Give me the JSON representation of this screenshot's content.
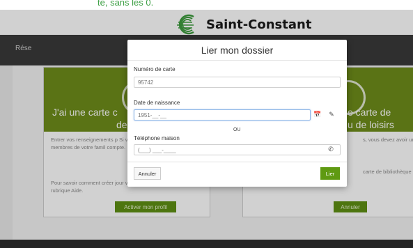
{
  "top_strip": {
    "text": "te, sans les 0."
  },
  "header": {
    "logo_text": "Saint-Constant"
  },
  "navbar": {
    "item": "Rése"
  },
  "cards": {
    "left": {
      "title_line1": "J'ai une carte c",
      "title_line2": "de",
      "body_para1": "Entrer vos renseignements p Si vous avez crée un dossie les membres de votre famil compte.",
      "body_para2": "Pour savoir comment créer jour votre dossier, consultez la rubrique Aide.",
      "button": "Activer mon profil"
    },
    "right": {
      "title_line1": "e carte de",
      "title_line2": "u de loisirs",
      "body_para1": "s, vous devez avoir une c",
      "body_para2": "carte de bibliothèque ou",
      "button": "Annuler"
    }
  },
  "modal": {
    "title": "Lier mon dossier",
    "card_number_label": "Numéro de carte",
    "card_number_value": "95742",
    "birthdate_label": "Date de naissance",
    "birthdate_value": "1951-__-__",
    "or_text": "OU",
    "home_phone_label": "Téléphone maison",
    "home_phone_value": "(___) ___-____",
    "cancel_button": "Annuler",
    "link_button": "Lier"
  },
  "colors": {
    "accent_green": "#6e8d1a",
    "button_green": "#5f9a12",
    "navbar": "#3a3a3a"
  },
  "icons": {
    "calendar": "calendar-icon",
    "eraser": "eraser-icon",
    "phone": "phone-icon"
  }
}
